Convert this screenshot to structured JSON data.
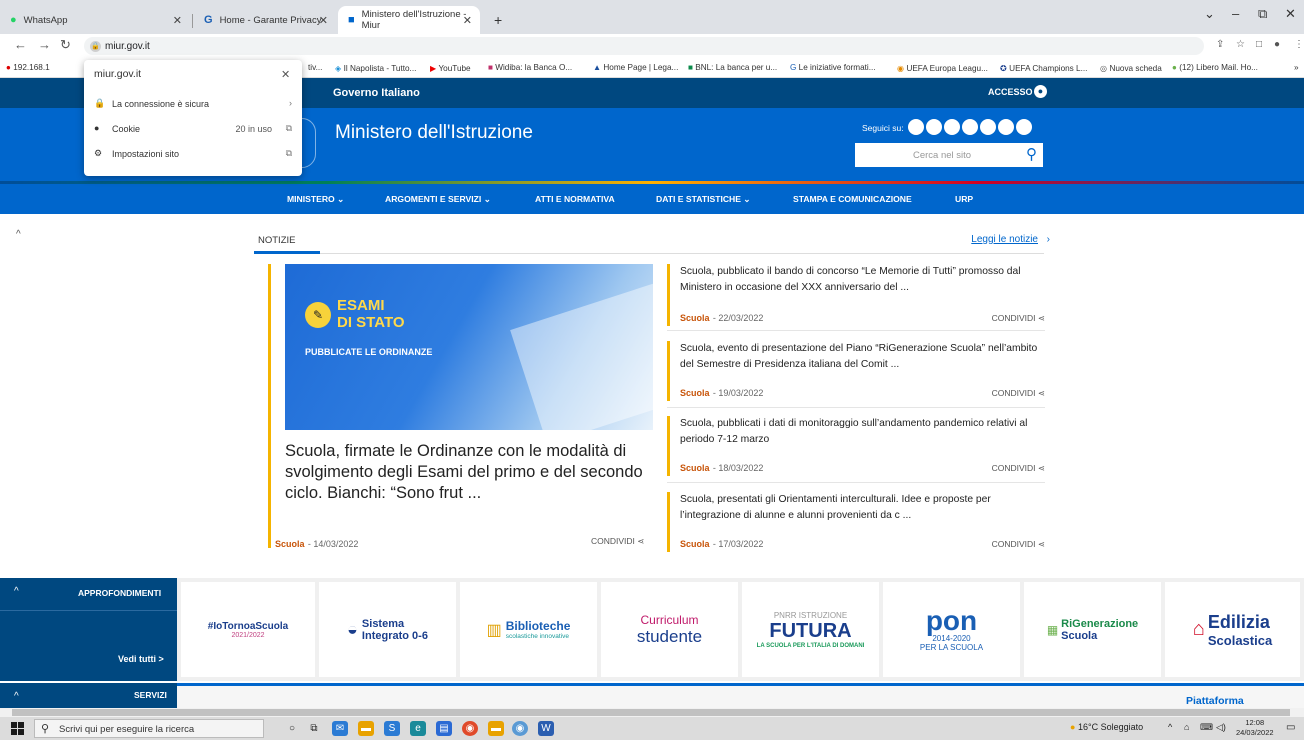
{
  "browser": {
    "tabs": [
      {
        "title": "WhatsApp"
      },
      {
        "title": "Home - Garante Privacy"
      },
      {
        "title": "Ministero dell'Istruzione - Miur"
      }
    ],
    "url": "miur.gov.it",
    "bookmarks": [
      "192.168.1",
      "tiv...",
      "Il Napolista - Tutto...",
      "YouTube",
      "Widiba: la Banca O...",
      "Home Page | Lega...",
      "BNL: La banca per u...",
      "Le iniziative formati...",
      "UEFA Europa Leagu...",
      "UEFA Champions L...",
      "Nuova scheda",
      "(12) Libero Mail. Ho..."
    ],
    "more": "»"
  },
  "site_popup": {
    "title": "miur.gov.it",
    "rows": [
      {
        "label": "La connessione è sicura",
        "value": "",
        "end": "›"
      },
      {
        "label": "Cookie",
        "value": "20 in uso",
        "end": "⧉"
      },
      {
        "label": "Impostazioni sito",
        "value": "",
        "end": "⧉"
      }
    ]
  },
  "site": {
    "gov_title": "Governo Italiano",
    "access_label": "ACCESSO",
    "ministry_title": "Ministero dell'Istruzione",
    "follow_label": "Seguici su:",
    "search_placeholder": "Cerca nel sito",
    "menu": [
      "MINISTERO",
      "ARGOMENTI E SERVIZI",
      "ATTI E NORMATIVA",
      "DATI E STATISTICHE",
      "STAMPA E COMUNICAZIONE",
      "URP"
    ],
    "news_tab": "NOTIZIE",
    "read_all": "Leggi le notizie",
    "featured": {
      "img_line1": "ESAMI",
      "img_line2": "DI STATO",
      "img_line3": "PUBBLICATE LE ORDINANZE",
      "title": "Scuola, firmate le Ordinanze con le modalità di svolgimento degli Esami del primo e del secondo ciclo. Bianchi: “Sono frut ...",
      "category": "Scuola",
      "date": "- 14/03/2022",
      "share": "CONDIVIDI"
    },
    "news": [
      {
        "title": "Scuola, pubblicato il bando di concorso “Le Memorie di Tutti” promosso dal Ministero in occasione del XXX anniversario del ...",
        "category": "Scuola",
        "date": "- 22/03/2022",
        "share": "CONDIVIDI"
      },
      {
        "title": "Scuola, evento di presentazione del Piano “RiGenerazione Scuola” nell’ambito del Semestre di Presidenza italiana del Comit ...",
        "category": "Scuola",
        "date": "- 19/03/2022",
        "share": "CONDIVIDI"
      },
      {
        "title": "Scuola, pubblicati i dati di monitoraggio sull’andamento pandemico relativi al periodo 7-12 marzo",
        "category": "Scuola",
        "date": "- 18/03/2022",
        "share": "CONDIVIDI"
      },
      {
        "title": "Scuola, presentati gli Orientamenti interculturali. Idee e proposte per l’integrazione di alunne e alunni provenienti da c ...",
        "category": "Scuola",
        "date": "- 17/03/2022",
        "share": "CONDIVIDI"
      }
    ],
    "approfondimenti_label": "APPROFONDIMENTI",
    "see_all": "Vedi tutti >",
    "logos": [
      {
        "l1": "#IoTornoaScuola",
        "l2": "2021/2022"
      },
      {
        "l1": "Sistema",
        "l2": "Integrato 0-6"
      },
      {
        "l1": "Biblioteche",
        "l2": "scolastiche innovative"
      },
      {
        "l1": "Curriculum",
        "l2": "studente"
      },
      {
        "l1": "PNRR ISTRUZIONE",
        "l2": "FUTURA",
        "l3": "LA SCUOLA PER L'ITALIA DI DOMANI"
      },
      {
        "l1": "pon",
        "l2": "2014-2020",
        "l3": "PER LA SCUOLA"
      },
      {
        "l1": "RiGenerazione",
        "l2": "Scuola"
      },
      {
        "l1": "Edilizia",
        "l2": "Scolastica"
      }
    ],
    "servizi_label": "SERVIZI",
    "piattaforma_label": "Piattaforma"
  },
  "taskbar": {
    "search_placeholder": "Scrivi qui per eseguire la ricerca",
    "weather": "16°C Soleggiato",
    "time": "12:08",
    "date": "24/03/2022"
  },
  "colors": {
    "brand": "#0066cc",
    "dark": "#004880",
    "accent": "#f5b400",
    "category": "#c8550a"
  }
}
